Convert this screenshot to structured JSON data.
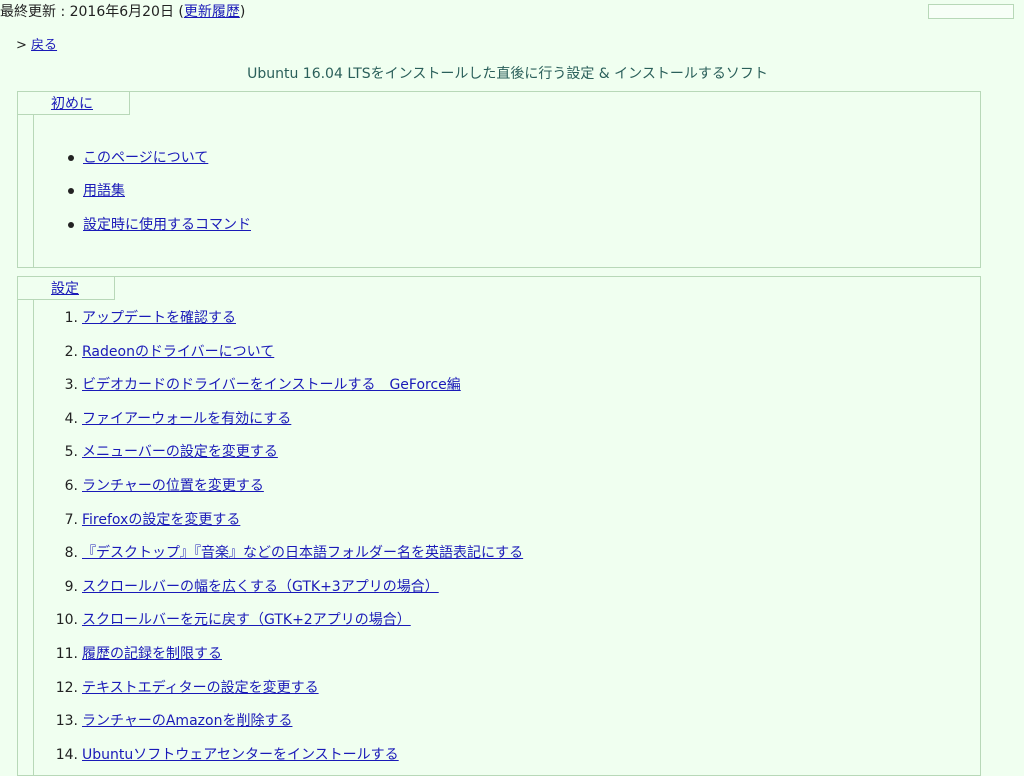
{
  "header": {
    "last_updated": "最終更新 : 2016年6月20日 (",
    "history_link": "更新履歴",
    "close_paren": ")"
  },
  "nav": {
    "back_prefix": ">",
    "back_link": "戻る"
  },
  "page_title": "Ubuntu 16.04 LTSをインストールした直後に行う設定 & インストールするソフト",
  "sections": [
    {
      "heading": "初めに",
      "items": [
        "このページについて",
        "用語集",
        "設定時に使用するコマンド"
      ]
    },
    {
      "heading": "設定",
      "items": [
        {
          "num": "1.",
          "label": "アップデートを確認する"
        },
        {
          "num": "2.",
          "label": "Radeonのドライバーについて"
        },
        {
          "num": "3.",
          "label": "ビデオカードのドライバーをインストールする　GeForce編"
        },
        {
          "num": "4.",
          "label": "ファイアーウォールを有効にする"
        },
        {
          "num": "5.",
          "label": "メニューバーの設定を変更する"
        },
        {
          "num": "6.",
          "label": "ランチャーの位置を変更する"
        },
        {
          "num": "7.",
          "label": "Firefoxの設定を変更する"
        },
        {
          "num": "8.",
          "label": "『デスクトップ』『音楽』などの日本語フォルダー名を英語表記にする"
        },
        {
          "num": "9.",
          "label": "スクロールバーの幅を広くする（GTK+3アプリの場合）"
        },
        {
          "num": "10.",
          "label": "スクロールバーを元に戻す（GTK+2アプリの場合）"
        },
        {
          "num": "11.",
          "label": "履歴の記録を制限する"
        },
        {
          "num": "12.",
          "label": "テキストエディターの設定を変更する"
        },
        {
          "num": "13.",
          "label": "ランチャーのAmazonを削除する"
        },
        {
          "num": "14.",
          "label": "Ubuntuソフトウェアセンターをインストールする"
        }
      ]
    }
  ]
}
